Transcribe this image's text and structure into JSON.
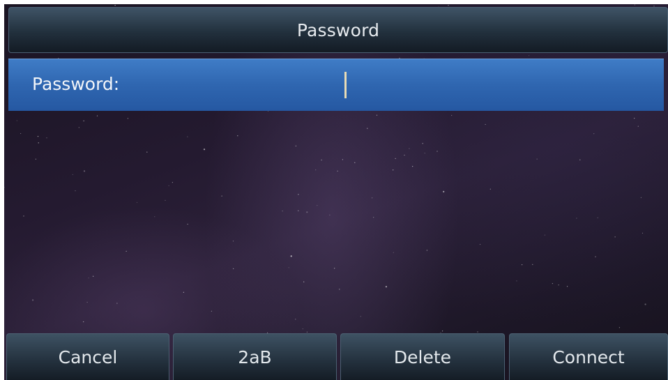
{
  "screen": {
    "title": "Password"
  },
  "form": {
    "password_label": "Password:",
    "password_value": ""
  },
  "softkeys": [
    {
      "label": "Cancel"
    },
    {
      "label": "2aB"
    },
    {
      "label": "Delete"
    },
    {
      "label": "Connect"
    }
  ],
  "colors": {
    "title_bar": "#22303d",
    "selected_row": "#2f66b0",
    "softkey": "#253340",
    "cursor": "#e8dcb6"
  }
}
